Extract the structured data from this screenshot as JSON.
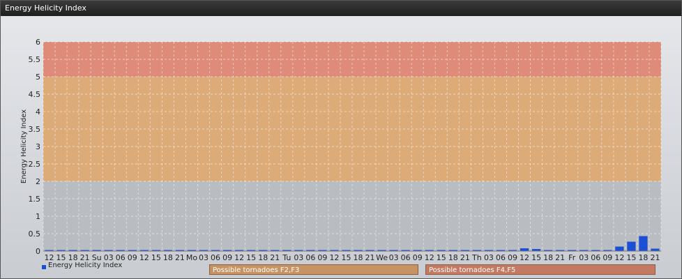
{
  "window": {
    "title": "Energy Helicity Index"
  },
  "legend": {
    "label": "Energy Helicity Index",
    "color": "#1a4fd6"
  },
  "bands": [
    {
      "label": "Possible tornadoes F2,F3",
      "from": 2,
      "to": 5,
      "color": "#e2a86b"
    },
    {
      "label": "Possible tornadoes F4,F5",
      "from": 5,
      "to": 6,
      "color": "#e4836d"
    }
  ],
  "chart_data": {
    "type": "bar",
    "ylabel": "Energy Helicity Index",
    "ylim": [
      0,
      6
    ],
    "yticks": [
      0,
      0.5,
      1,
      1.5,
      2,
      2.5,
      3,
      3.5,
      4,
      4.5,
      5,
      5.5,
      6
    ],
    "grid": true,
    "categories": [
      "12",
      "15",
      "18",
      "21",
      "Su",
      "03",
      "06",
      "09",
      "12",
      "15",
      "18",
      "21",
      "Mo",
      "03",
      "06",
      "09",
      "12",
      "15",
      "18",
      "21",
      "Tu",
      "03",
      "06",
      "09",
      "12",
      "15",
      "18",
      "21",
      "We",
      "03",
      "06",
      "09",
      "12",
      "15",
      "18",
      "21",
      "Th",
      "03",
      "06",
      "09",
      "12",
      "15",
      "18",
      "21",
      "Fr",
      "03",
      "06",
      "09",
      "12",
      "15",
      "18",
      "21"
    ],
    "series": [
      {
        "name": "Energy Helicity Index",
        "values": [
          0.01,
          0.01,
          0.01,
          0.01,
          0.01,
          0.01,
          0.01,
          0.01,
          0.01,
          0.01,
          0.01,
          0.01,
          0.01,
          0.01,
          0.01,
          0.01,
          0.01,
          0.01,
          0.01,
          0.01,
          0.01,
          0.01,
          0.01,
          0.01,
          0.01,
          0.01,
          0.01,
          0.01,
          0.01,
          0.01,
          0.01,
          0.01,
          0.01,
          0.01,
          0.01,
          0.01,
          0.01,
          0.01,
          0.01,
          0.01,
          0.08,
          0.06,
          0.02,
          0.01,
          0.01,
          0.01,
          0.01,
          0.01,
          0.13,
          0.27,
          0.43,
          0.07
        ]
      }
    ]
  }
}
